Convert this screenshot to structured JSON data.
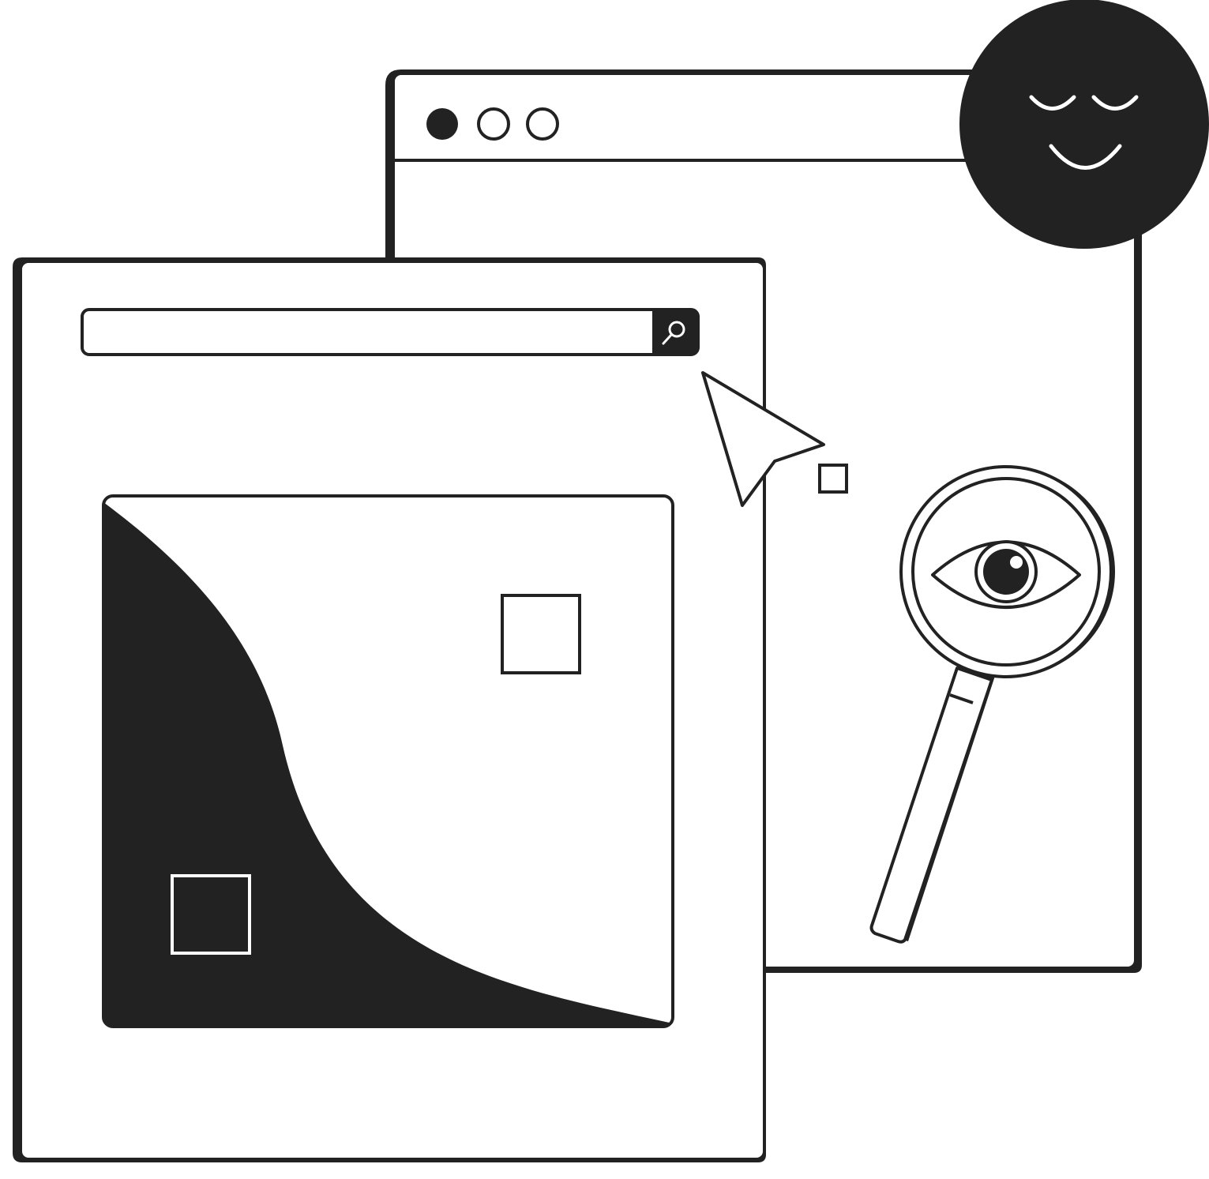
{
  "colors": {
    "ink": "#222222",
    "paper": "#ffffff"
  },
  "back_window": {
    "title_bar": {
      "controls": [
        "close-dot-filled",
        "minimize-dot-outline",
        "maximize-dot-outline"
      ]
    }
  },
  "front_window": {
    "search": {
      "value": "",
      "placeholder": "",
      "button_icon": "search-icon"
    },
    "image_placeholder": {
      "icon": "image-placeholder-icon"
    }
  },
  "decorations": {
    "avatar_icon": "smiley-face-icon",
    "cursor_icon": "pointer-cursor-icon",
    "magnifier_icon": "magnifying-glass-eye-icon"
  }
}
